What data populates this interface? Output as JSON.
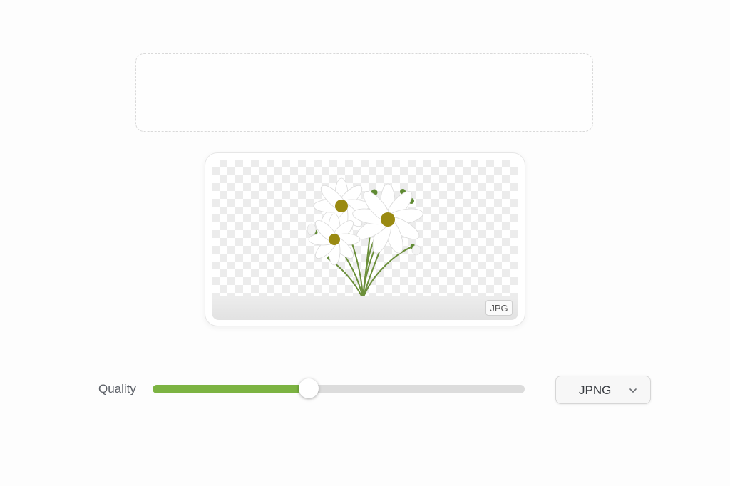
{
  "preview": {
    "format_badge": "JPG"
  },
  "controls": {
    "quality_label": "Quality",
    "quality_value_fraction": 0.42,
    "format_value": "JPNG",
    "accent_color": "#7cb342"
  },
  "icons": {
    "dropdown": "chevron-down-icon"
  }
}
